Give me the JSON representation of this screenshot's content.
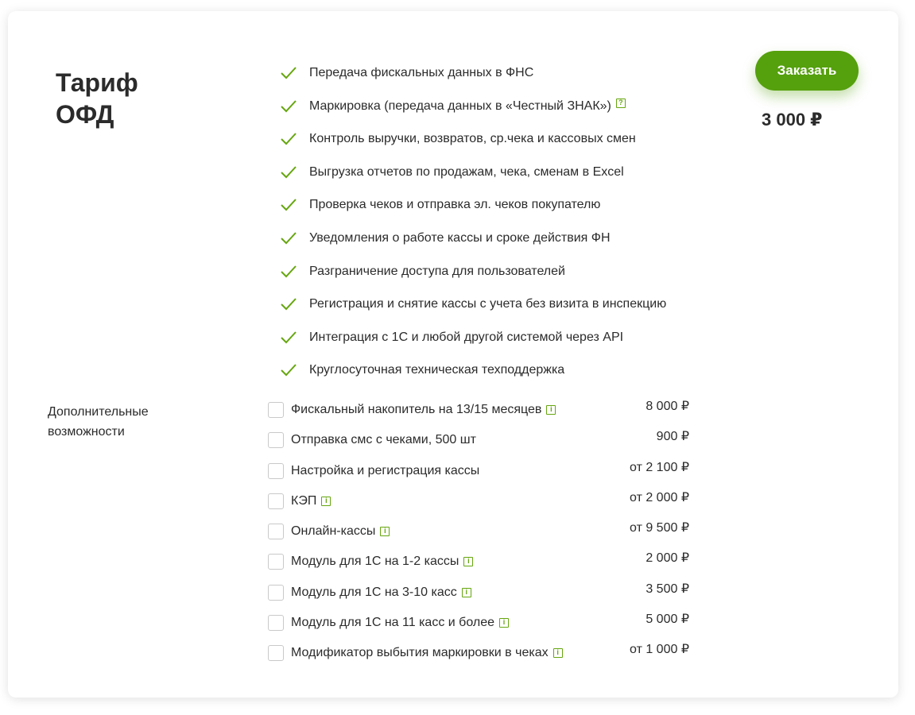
{
  "tariff": {
    "title_line1": "Тариф",
    "title_line2": "ОФД",
    "order_label": "Заказать",
    "price": "3 000 ₽"
  },
  "features": [
    {
      "text": "Передача фискальных данных в ФНС",
      "help": false
    },
    {
      "text": "Маркировка (передача данных в «Честный ЗНАК»)",
      "help": true
    },
    {
      "text": "Контроль выручки, возвратов, ср.чека и кассовых смен",
      "help": false
    },
    {
      "text": "Выгрузка отчетов по продажам, чека, сменам в Excel",
      "help": false
    },
    {
      "text": "Проверка чеков и отправка эл. чеков покупателю",
      "help": false
    },
    {
      "text": "Уведомления о работе кассы и сроке действия ФН",
      "help": false
    },
    {
      "text": "Разграничение доступа для пользователей",
      "help": false
    },
    {
      "text": "Регистрация и снятие кассы с учета без визита в инспекцию",
      "help": false
    },
    {
      "text": "Интеграция с 1С и любой другой системой через API",
      "help": false
    },
    {
      "text": "Круглосуточная техническая техподдержка",
      "help": false
    }
  ],
  "extras_label": "Дополнительные возможности",
  "extras": [
    {
      "name": "Фискальный накопитель на 13/15 месяцев",
      "price": "8 000 ₽",
      "info": true
    },
    {
      "name": "Отправка смс с чеками, 500 шт",
      "price": "900 ₽",
      "info": false
    },
    {
      "name": "Настройка и регистрация кассы",
      "price": "от 2 100 ₽",
      "info": false
    },
    {
      "name": "КЭП",
      "price": "от 2 000 ₽",
      "info": true
    },
    {
      "name": "Онлайн-кассы",
      "price": "от 9 500 ₽",
      "info": true
    },
    {
      "name": "Модуль для 1С на 1-2 кассы",
      "price": "2 000 ₽",
      "info": true
    },
    {
      "name": "Модуль для 1С на 3-10 касс",
      "price": "3 500 ₽",
      "info": true
    },
    {
      "name": "Модуль для 1С на 11 касс и более",
      "price": "5 000 ₽",
      "info": true
    },
    {
      "name": "Модификатор выбытия маркировки в чеках",
      "price": "от 1 000 ₽",
      "info": true
    }
  ],
  "icons": {
    "check": "check-icon",
    "help": "question-icon",
    "info": "info-icon"
  },
  "colors": {
    "accent": "#55a00d",
    "icon": "#66a60f"
  }
}
